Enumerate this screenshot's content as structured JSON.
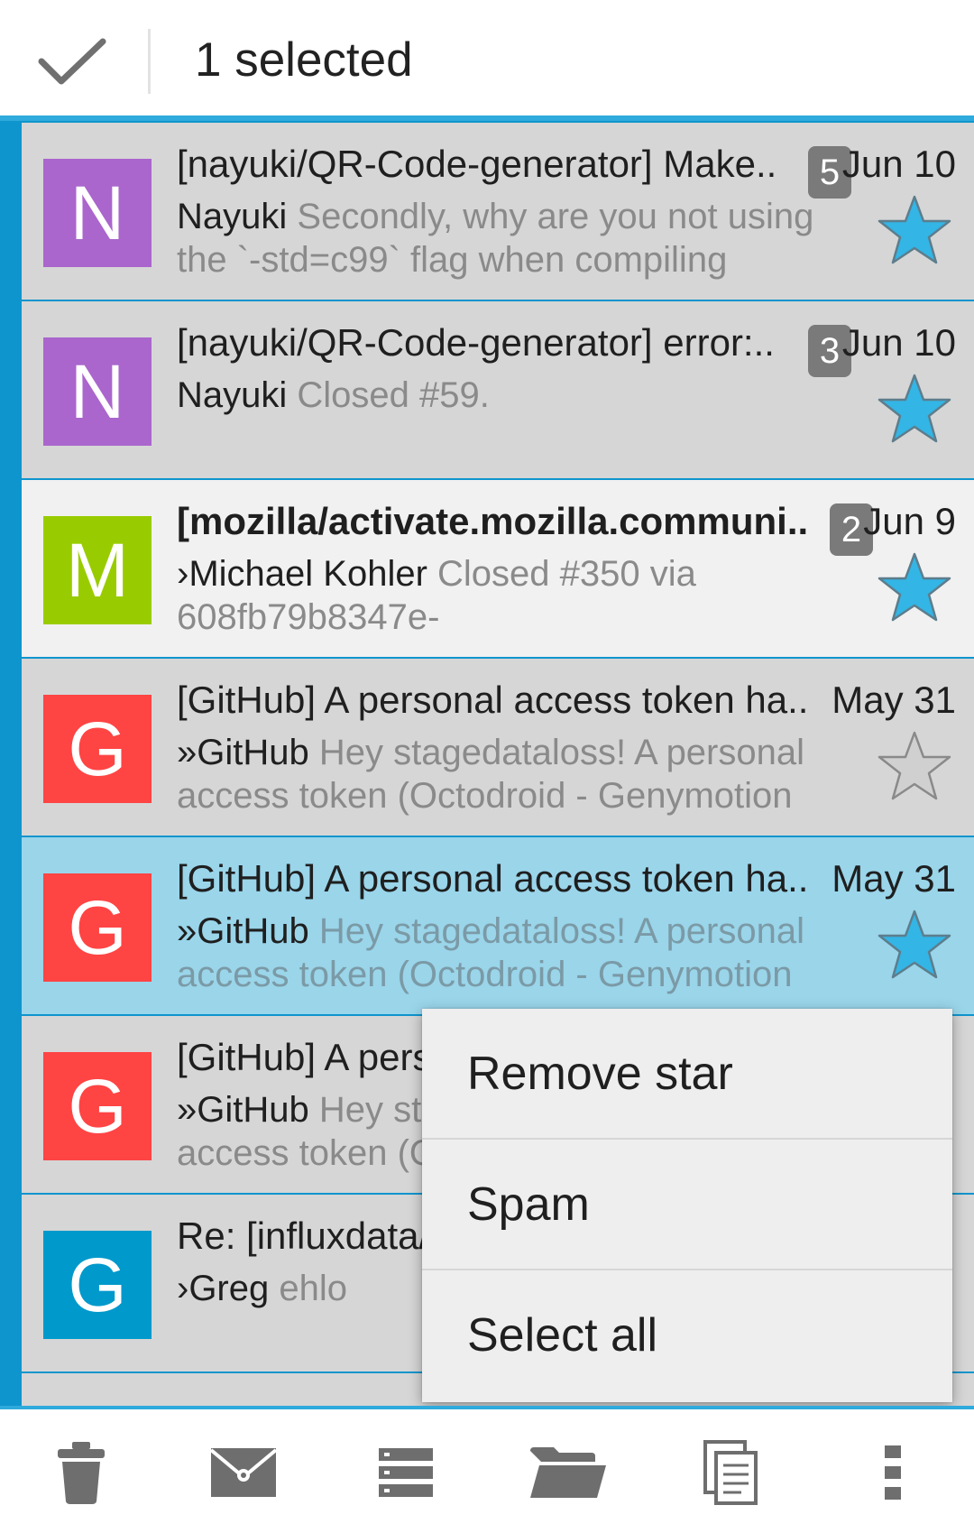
{
  "topbar": {
    "title": "1 selected",
    "check_icon": "check-icon"
  },
  "messages": [
    {
      "initial": "N",
      "avatar_color": "#aa66cc",
      "subject": "[nayuki/QR-Code-generator] Make..",
      "count": "5",
      "date": "Jun 10",
      "sender": "Nayuki",
      "snippet": "Secondly, why are you not using the `-std=c99` flag when compiling",
      "starred": true,
      "state": "read"
    },
    {
      "initial": "N",
      "avatar_color": "#aa66cc",
      "subject": "[nayuki/QR-Code-generator] error:..",
      "count": "3",
      "date": "Jun 10",
      "sender": "Nayuki",
      "snippet": "Closed #59.",
      "starred": true,
      "state": "read"
    },
    {
      "initial": "M",
      "avatar_color": "#99cc00",
      "subject": "[mozilla/activate.mozilla.communi..",
      "count": "2",
      "date": "Jun 9",
      "sender": "›Michael Kohler",
      "snippet": "Closed #350 via 608fb79b8347e-",
      "starred": true,
      "state": "unread"
    },
    {
      "initial": "G",
      "avatar_color": "#ff4444",
      "subject": "[GitHub] A personal access token ha..",
      "count": "",
      "date": "May 31",
      "sender": "»GitHub",
      "snippet": "Hey stagedataloss! A personal access token (Octodroid - Genymotion",
      "starred": false,
      "state": "read"
    },
    {
      "initial": "G",
      "avatar_color": "#ff4444",
      "subject": "[GitHub] A personal access token ha..",
      "count": "",
      "date": "May 31",
      "sender": "»GitHub",
      "snippet": "Hey stagedataloss! A personal access token (Octodroid - Genymotion",
      "starred": true,
      "state": "selected"
    },
    {
      "initial": "G",
      "avatar_color": "#ff4444",
      "subject": "[GitHub] A personal access token ha..",
      "count": "",
      "date": "",
      "sender": "»GitHub",
      "snippet": "Hey stagedataloss! A personal access token (Octodroid - Genymotion",
      "starred": false,
      "state": "read"
    },
    {
      "initial": "G",
      "avatar_color": "#0099cc",
      "subject": "Re: [influxdata/",
      "count": "",
      "date": "",
      "sender": "›Greg",
      "snippet": "ehlo",
      "starred": false,
      "state": "read"
    }
  ],
  "menu": {
    "items": [
      "Remove star",
      "Spam",
      "Select all"
    ]
  },
  "toolbar": {
    "icons": [
      "trash-icon",
      "mark-read-icon",
      "list-icon",
      "folder-icon",
      "copy-icon",
      "overflow-icon"
    ]
  },
  "colors": {
    "accent": "#2eaadc",
    "star_filled": "#33b5e5",
    "star_empty": "#c8c8c8",
    "selected_row": "#9ad5ea"
  }
}
